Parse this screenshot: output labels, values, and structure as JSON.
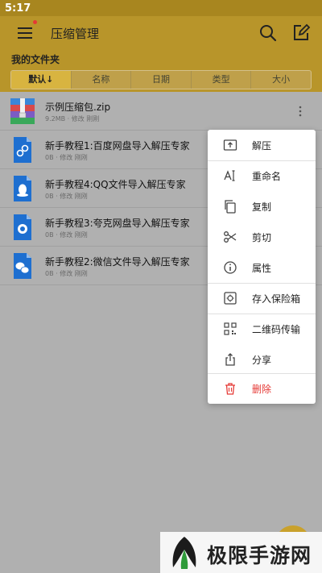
{
  "status": {
    "time": "5:17"
  },
  "header": {
    "title": "压缩管理"
  },
  "folder_label": "我的文件夹",
  "sort_tabs": [
    "默认↓",
    "名称",
    "日期",
    "类型",
    "大小"
  ],
  "files": [
    {
      "name": "示例压缩包.zip",
      "meta": "9.2MB · 修改 刚刚",
      "icon": "zip-archive-icon"
    },
    {
      "name": "新手教程1:百度网盘导入解压专家",
      "meta": "0B · 修改 刚刚",
      "icon": "link-file-icon"
    },
    {
      "name": "新手教程4:QQ文件导入解压专家",
      "meta": "0B · 修改 刚刚",
      "icon": "qq-file-icon"
    },
    {
      "name": "新手教程3:夸克网盘导入解压专家",
      "meta": "0B · 修改 刚刚",
      "icon": "quark-file-icon"
    },
    {
      "name": "新手教程2:微信文件导入解压专家",
      "meta": "0B · 修改 刚刚",
      "icon": "wechat-file-icon"
    }
  ],
  "context_menu": [
    {
      "label": "解压",
      "icon": "extract-icon"
    },
    {
      "label": "重命名",
      "icon": "rename-icon"
    },
    {
      "label": "复制",
      "icon": "copy-icon"
    },
    {
      "label": "剪切",
      "icon": "scissors-icon"
    },
    {
      "label": "属性",
      "icon": "info-icon"
    },
    {
      "label": "存入保险箱",
      "icon": "safe-box-icon"
    },
    {
      "label": "二维码传输",
      "icon": "qr-code-icon"
    },
    {
      "label": "分享",
      "icon": "share-icon"
    },
    {
      "label": "删除",
      "icon": "trash-icon"
    }
  ],
  "watermark": {
    "text": "极限手游网"
  },
  "colors": {
    "accent": "#b8952a",
    "danger": "#e53935",
    "file_blue": "#1e6fd0"
  }
}
